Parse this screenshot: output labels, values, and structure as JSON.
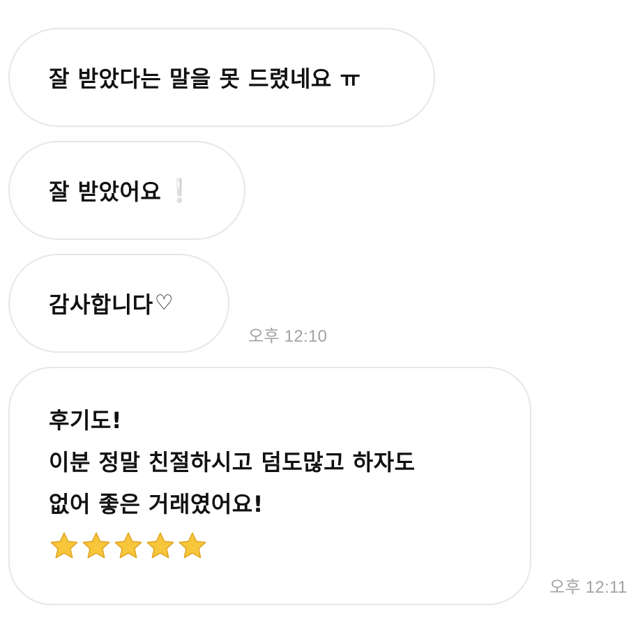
{
  "messages": [
    {
      "text": "잘 받았다는 말을 못 드렸네요 ㅠ"
    },
    {
      "text": "잘 받았어요",
      "trailing_icon": "white-exclamation-icon",
      "trailing_glyph": "❕"
    },
    {
      "text": "감사합니다",
      "trailing_icon": "heart-outline-icon",
      "trailing_glyph": "♡",
      "time": "오후 12:10"
    },
    {
      "lines": [
        "후기도!",
        "이분 정말 친절하시고 덤도많고 하자도",
        "없어 좋은 거래였어요!"
      ],
      "rating": 5,
      "rating_icon": "star-icon",
      "time": "오후 12:11"
    }
  ],
  "colors": {
    "bubble_border": "#e7e7e9",
    "text": "#111111",
    "time": "#a3a3a3",
    "star": "#f7c63a"
  }
}
